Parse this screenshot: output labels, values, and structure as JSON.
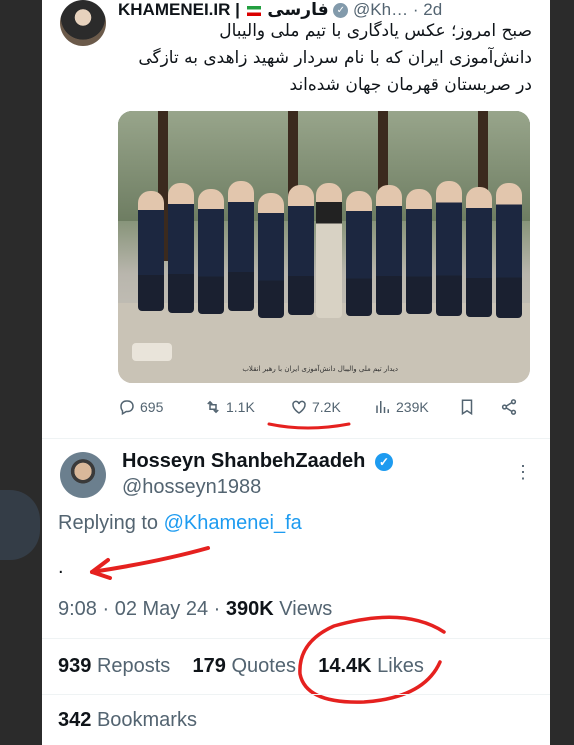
{
  "tweet": {
    "author_name": "KHAMENEI.IR",
    "author_suffix": "فارسی",
    "handle": "@Kh…",
    "separator": "·",
    "age": "2d",
    "text_line1": "صبح امروز؛ عکس یادگاری با تیم ملی والیبال",
    "text_line2": "دانش‌آموزی ایران که با نام سردار شهید زاهدی به تازگی",
    "text_line3": "در صربستان قهرمان جهان شده‌اند",
    "photo_caption": "دیدار تیم ملی والیبال دانش‌آموزی ایران با رهبر انقلاب",
    "actions": {
      "replies": "695",
      "reposts": "1.1K",
      "likes": "7.2K",
      "views": "239K"
    }
  },
  "reply": {
    "name": "Hosseyn ShanbehZaadeh",
    "handle": "@hosseyn1988",
    "replying_prefix": "Replying to",
    "replying_to": "@Khamenei_fa",
    "body": ".",
    "time": "9:08",
    "date": "02 May 24",
    "views_count": "390K",
    "views_label": "Views",
    "reposts_count": "939",
    "reposts_label": "Reposts",
    "quotes_count": "179",
    "quotes_label": "Quotes",
    "likes_count": "14.4K",
    "likes_label": "Likes",
    "bookmarks_count": "342",
    "bookmarks_label": "Bookmarks"
  },
  "colors": {
    "accent": "#1d9bf0",
    "muted": "#536471",
    "annotation_red": "#e5211f"
  },
  "icons": [
    "reply-icon",
    "repost-icon",
    "heart-icon",
    "views-icon",
    "bookmark-icon",
    "share-icon",
    "verified-icon",
    "more-icon"
  ]
}
